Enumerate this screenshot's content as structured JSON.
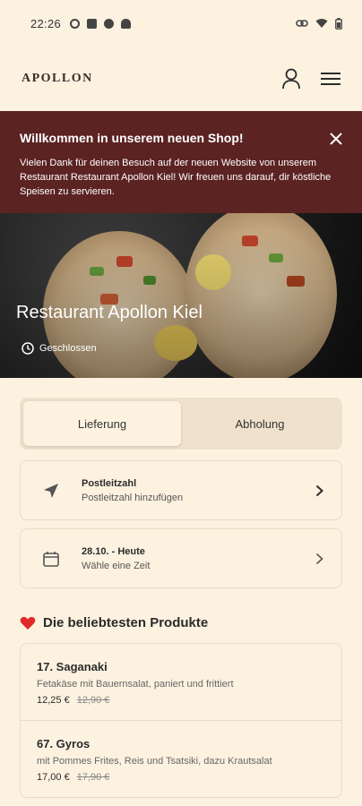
{
  "statusbar": {
    "time": "22:26"
  },
  "header": {
    "logo": "APOLLON"
  },
  "banner": {
    "title": "Willkommen in unserem neuen Shop!",
    "text": "Vielen Dank für deinen Besuch auf der neuen Website von unserem Restaurant Restaurant Apollon Kiel! Wir freuen uns darauf, dir köstliche Speisen zu servieren."
  },
  "hero": {
    "title": "Restaurant Apollon Kiel",
    "status": "Geschlossen"
  },
  "toggle": {
    "delivery": "Lieferung",
    "pickup": "Abholung"
  },
  "postcode": {
    "title": "Postleitzahl",
    "subtitle": "Postleitzahl hinzufügen"
  },
  "schedule": {
    "title": "28.10. - Heute",
    "subtitle": "Wähle eine Zeit"
  },
  "section": {
    "title": "Die beliebtesten Produkte"
  },
  "products": [
    {
      "name": "17. Saganaki",
      "desc": "Fetakäse mit Bauernsalat, paniert und frittiert",
      "price": "12,25 €",
      "old_price": "12,90 €"
    },
    {
      "name": "67. Gyros",
      "desc": "mit Pommes Frites, Reis und Tsatsiki, dazu Krautsalat",
      "price": "17,00 €",
      "old_price": "17,90 €"
    }
  ],
  "colors": {
    "background": "#fdf2e0",
    "banner": "#5b2322",
    "toggle_bg": "#efe1cc"
  }
}
